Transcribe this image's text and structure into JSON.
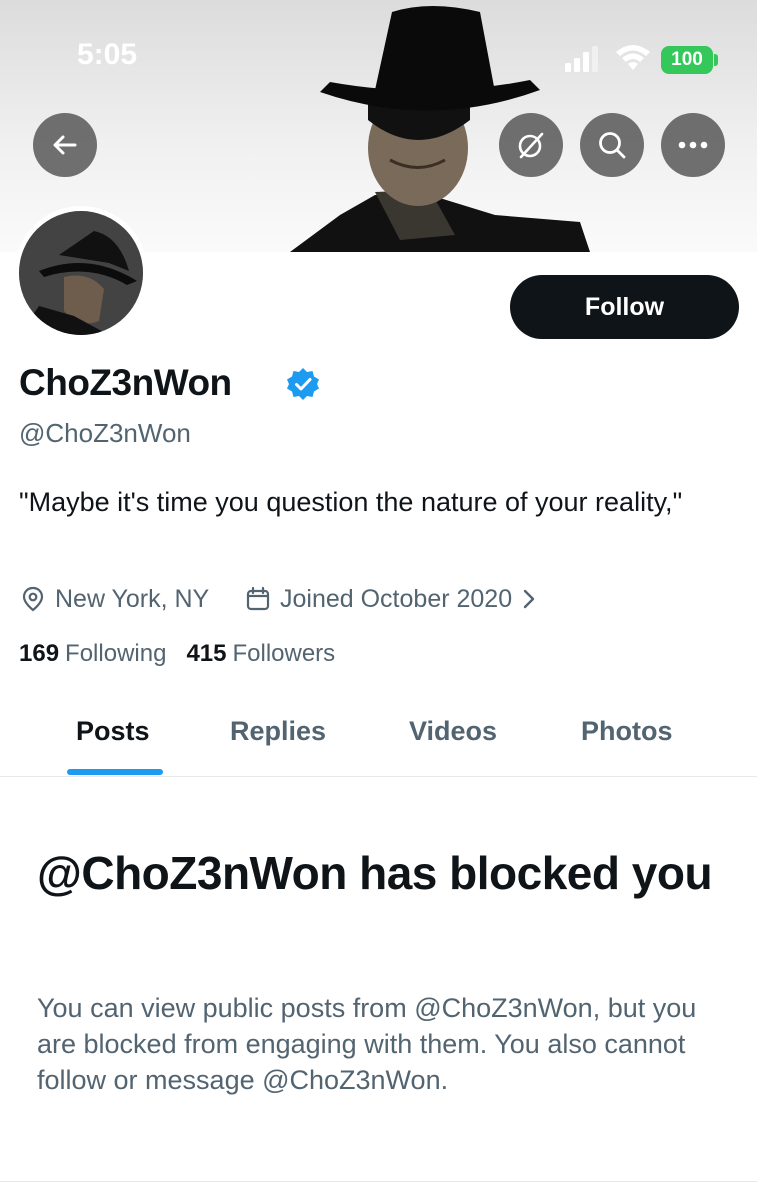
{
  "status_bar": {
    "time": "5:05",
    "battery": "100"
  },
  "header": {
    "back_icon": "arrow-left-icon",
    "grok_icon": "grok-slash-icon",
    "search_icon": "search-icon",
    "more_icon": "ellipsis-icon"
  },
  "profile": {
    "display_name": "ChoZ3nWon",
    "handle": "@ChoZ3nWon",
    "verified": true,
    "bio": "\"Maybe it's time you question the nature of your reality,\"",
    "location": "New York, NY",
    "joined": "Joined October 2020",
    "following_count": "169",
    "following_label": "Following",
    "followers_count": "415",
    "followers_label": "Followers",
    "follow_button": "Follow"
  },
  "tabs": [
    {
      "label": "Posts",
      "active": true
    },
    {
      "label": "Replies",
      "active": false
    },
    {
      "label": "Videos",
      "active": false
    },
    {
      "label": "Photos",
      "active": false
    }
  ],
  "blocked_notice": {
    "title": "@ChoZ3nWon has blocked you",
    "body": "You can view public posts from @ChoZ3nWon, but you are blocked from engaging with them. You also cannot follow or message @ChoZ3nWon."
  },
  "colors": {
    "accent": "#1d9bf0",
    "text_primary": "#0f1419",
    "text_secondary": "#536471",
    "battery": "#34c759"
  }
}
